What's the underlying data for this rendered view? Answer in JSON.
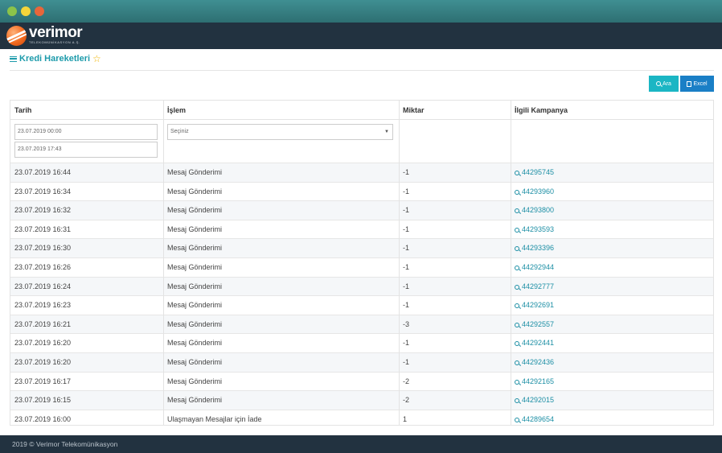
{
  "app": {
    "logo_name": "verimor",
    "logo_sub": "TELEKOMÜNİKASYON A.Ş."
  },
  "page": {
    "title": "Kredi Hareketleri"
  },
  "toolbar": {
    "search_label": "Ara",
    "excel_label": "Excel"
  },
  "table": {
    "headers": [
      "Tarih",
      "İşlem",
      "Miktar",
      "İlgili Kampanya"
    ],
    "filters": {
      "date_from": "23.07.2019 00:00",
      "date_to": "23.07.2019 17:43",
      "operation_select": "Seçiniz"
    },
    "rows": [
      {
        "date": "23.07.2019 16:44",
        "op": "Mesaj Gönderimi",
        "amount": "-1",
        "campaign": "44295745"
      },
      {
        "date": "23.07.2019 16:34",
        "op": "Mesaj Gönderimi",
        "amount": "-1",
        "campaign": "44293960"
      },
      {
        "date": "23.07.2019 16:32",
        "op": "Mesaj Gönderimi",
        "amount": "-1",
        "campaign": "44293800"
      },
      {
        "date": "23.07.2019 16:31",
        "op": "Mesaj Gönderimi",
        "amount": "-1",
        "campaign": "44293593"
      },
      {
        "date": "23.07.2019 16:30",
        "op": "Mesaj Gönderimi",
        "amount": "-1",
        "campaign": "44293396"
      },
      {
        "date": "23.07.2019 16:26",
        "op": "Mesaj Gönderimi",
        "amount": "-1",
        "campaign": "44292944"
      },
      {
        "date": "23.07.2019 16:24",
        "op": "Mesaj Gönderimi",
        "amount": "-1",
        "campaign": "44292777"
      },
      {
        "date": "23.07.2019 16:23",
        "op": "Mesaj Gönderimi",
        "amount": "-1",
        "campaign": "44292691"
      },
      {
        "date": "23.07.2019 16:21",
        "op": "Mesaj Gönderimi",
        "amount": "-3",
        "campaign": "44292557"
      },
      {
        "date": "23.07.2019 16:20",
        "op": "Mesaj Gönderimi",
        "amount": "-1",
        "campaign": "44292441"
      },
      {
        "date": "23.07.2019 16:20",
        "op": "Mesaj Gönderimi",
        "amount": "-1",
        "campaign": "44292436"
      },
      {
        "date": "23.07.2019 16:17",
        "op": "Mesaj Gönderimi",
        "amount": "-2",
        "campaign": "44292165"
      },
      {
        "date": "23.07.2019 16:15",
        "op": "Mesaj Gönderimi",
        "amount": "-2",
        "campaign": "44292015"
      },
      {
        "date": "23.07.2019 16:00",
        "op": "Ulaşmayan Mesajlar için İade",
        "amount": "1",
        "campaign": "44289654"
      }
    ]
  },
  "footer": {
    "text": "2019 © Verimor Telekomünikasyon"
  },
  "colors": {
    "accent": "#1d9bab",
    "header_bg": "#223240",
    "search_button": "#1bb6c4",
    "excel_button": "#1a7fc6"
  },
  "icons": {
    "title": "menu-icon",
    "favorite": "star-icon",
    "search": "search-icon",
    "excel": "excel-icon",
    "campaign_link": "search-icon"
  }
}
